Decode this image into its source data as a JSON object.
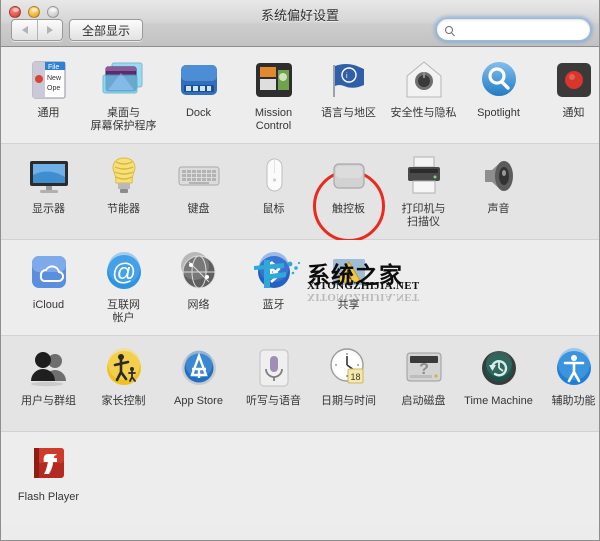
{
  "window": {
    "title": "系统偏好设置",
    "traffic_lights": [
      "close",
      "minimize",
      "zoom"
    ]
  },
  "toolbar": {
    "back_icon": "arrow-left-icon",
    "forward_icon": "arrow-right-icon",
    "show_all_label": "全部显示",
    "search": {
      "value": "",
      "placeholder": "",
      "icon": "search-icon"
    }
  },
  "rows": [
    {
      "name": "personal",
      "items": [
        {
          "label": "通用",
          "icon": "general-icon"
        },
        {
          "label": "桌面与\n屏幕保护程序",
          "icon": "desktop-screensaver-icon"
        },
        {
          "label": "Dock",
          "icon": "dock-icon"
        },
        {
          "label": "Mission\nControl",
          "icon": "mission-control-icon"
        },
        {
          "label": "语言与地区",
          "icon": "language-region-icon"
        },
        {
          "label": "安全性与隐私",
          "icon": "security-privacy-icon"
        },
        {
          "label": "Spotlight",
          "icon": "spotlight-icon"
        },
        {
          "label": "通知",
          "icon": "notifications-icon"
        }
      ]
    },
    {
      "name": "hardware",
      "items": [
        {
          "label": "显示器",
          "icon": "displays-icon"
        },
        {
          "label": "节能器",
          "icon": "energy-saver-icon"
        },
        {
          "label": "键盘",
          "icon": "keyboard-icon"
        },
        {
          "label": "鼠标",
          "icon": "mouse-icon"
        },
        {
          "label": "触控板",
          "icon": "trackpad-icon",
          "annotated": true
        },
        {
          "label": "打印机与\n扫描仪",
          "icon": "printers-scanners-icon"
        },
        {
          "label": "声音",
          "icon": "sound-icon"
        }
      ]
    },
    {
      "name": "internet-wireless",
      "items": [
        {
          "label": "iCloud",
          "icon": "icloud-icon"
        },
        {
          "label": "互联网\n帐户",
          "icon": "internet-accounts-icon"
        },
        {
          "label": "网络",
          "icon": "network-icon"
        },
        {
          "label": "蓝牙",
          "icon": "bluetooth-icon"
        },
        {
          "label": "共享",
          "icon": "sharing-icon"
        }
      ]
    },
    {
      "name": "system",
      "items": [
        {
          "label": "用户与群组",
          "icon": "users-groups-icon"
        },
        {
          "label": "家长控制",
          "icon": "parental-controls-icon"
        },
        {
          "label": "App Store",
          "icon": "app-store-icon"
        },
        {
          "label": "听写与语音",
          "icon": "dictation-speech-icon"
        },
        {
          "label": "日期与时间",
          "icon": "date-time-icon",
          "badge": "18"
        },
        {
          "label": "启动磁盘",
          "icon": "startup-disk-icon"
        },
        {
          "label": "Time Machine",
          "icon": "time-machine-icon"
        },
        {
          "label": "辅助功能",
          "icon": "accessibility-icon"
        }
      ]
    },
    {
      "name": "other",
      "items": [
        {
          "label": "Flash Player",
          "icon": "flash-player-icon"
        }
      ]
    }
  ],
  "annotation": {
    "color": "#ea2a1d",
    "target": "触控板"
  },
  "watermark": {
    "chinese": "系统之家",
    "english": "XITONGZHIJIA.NET"
  }
}
